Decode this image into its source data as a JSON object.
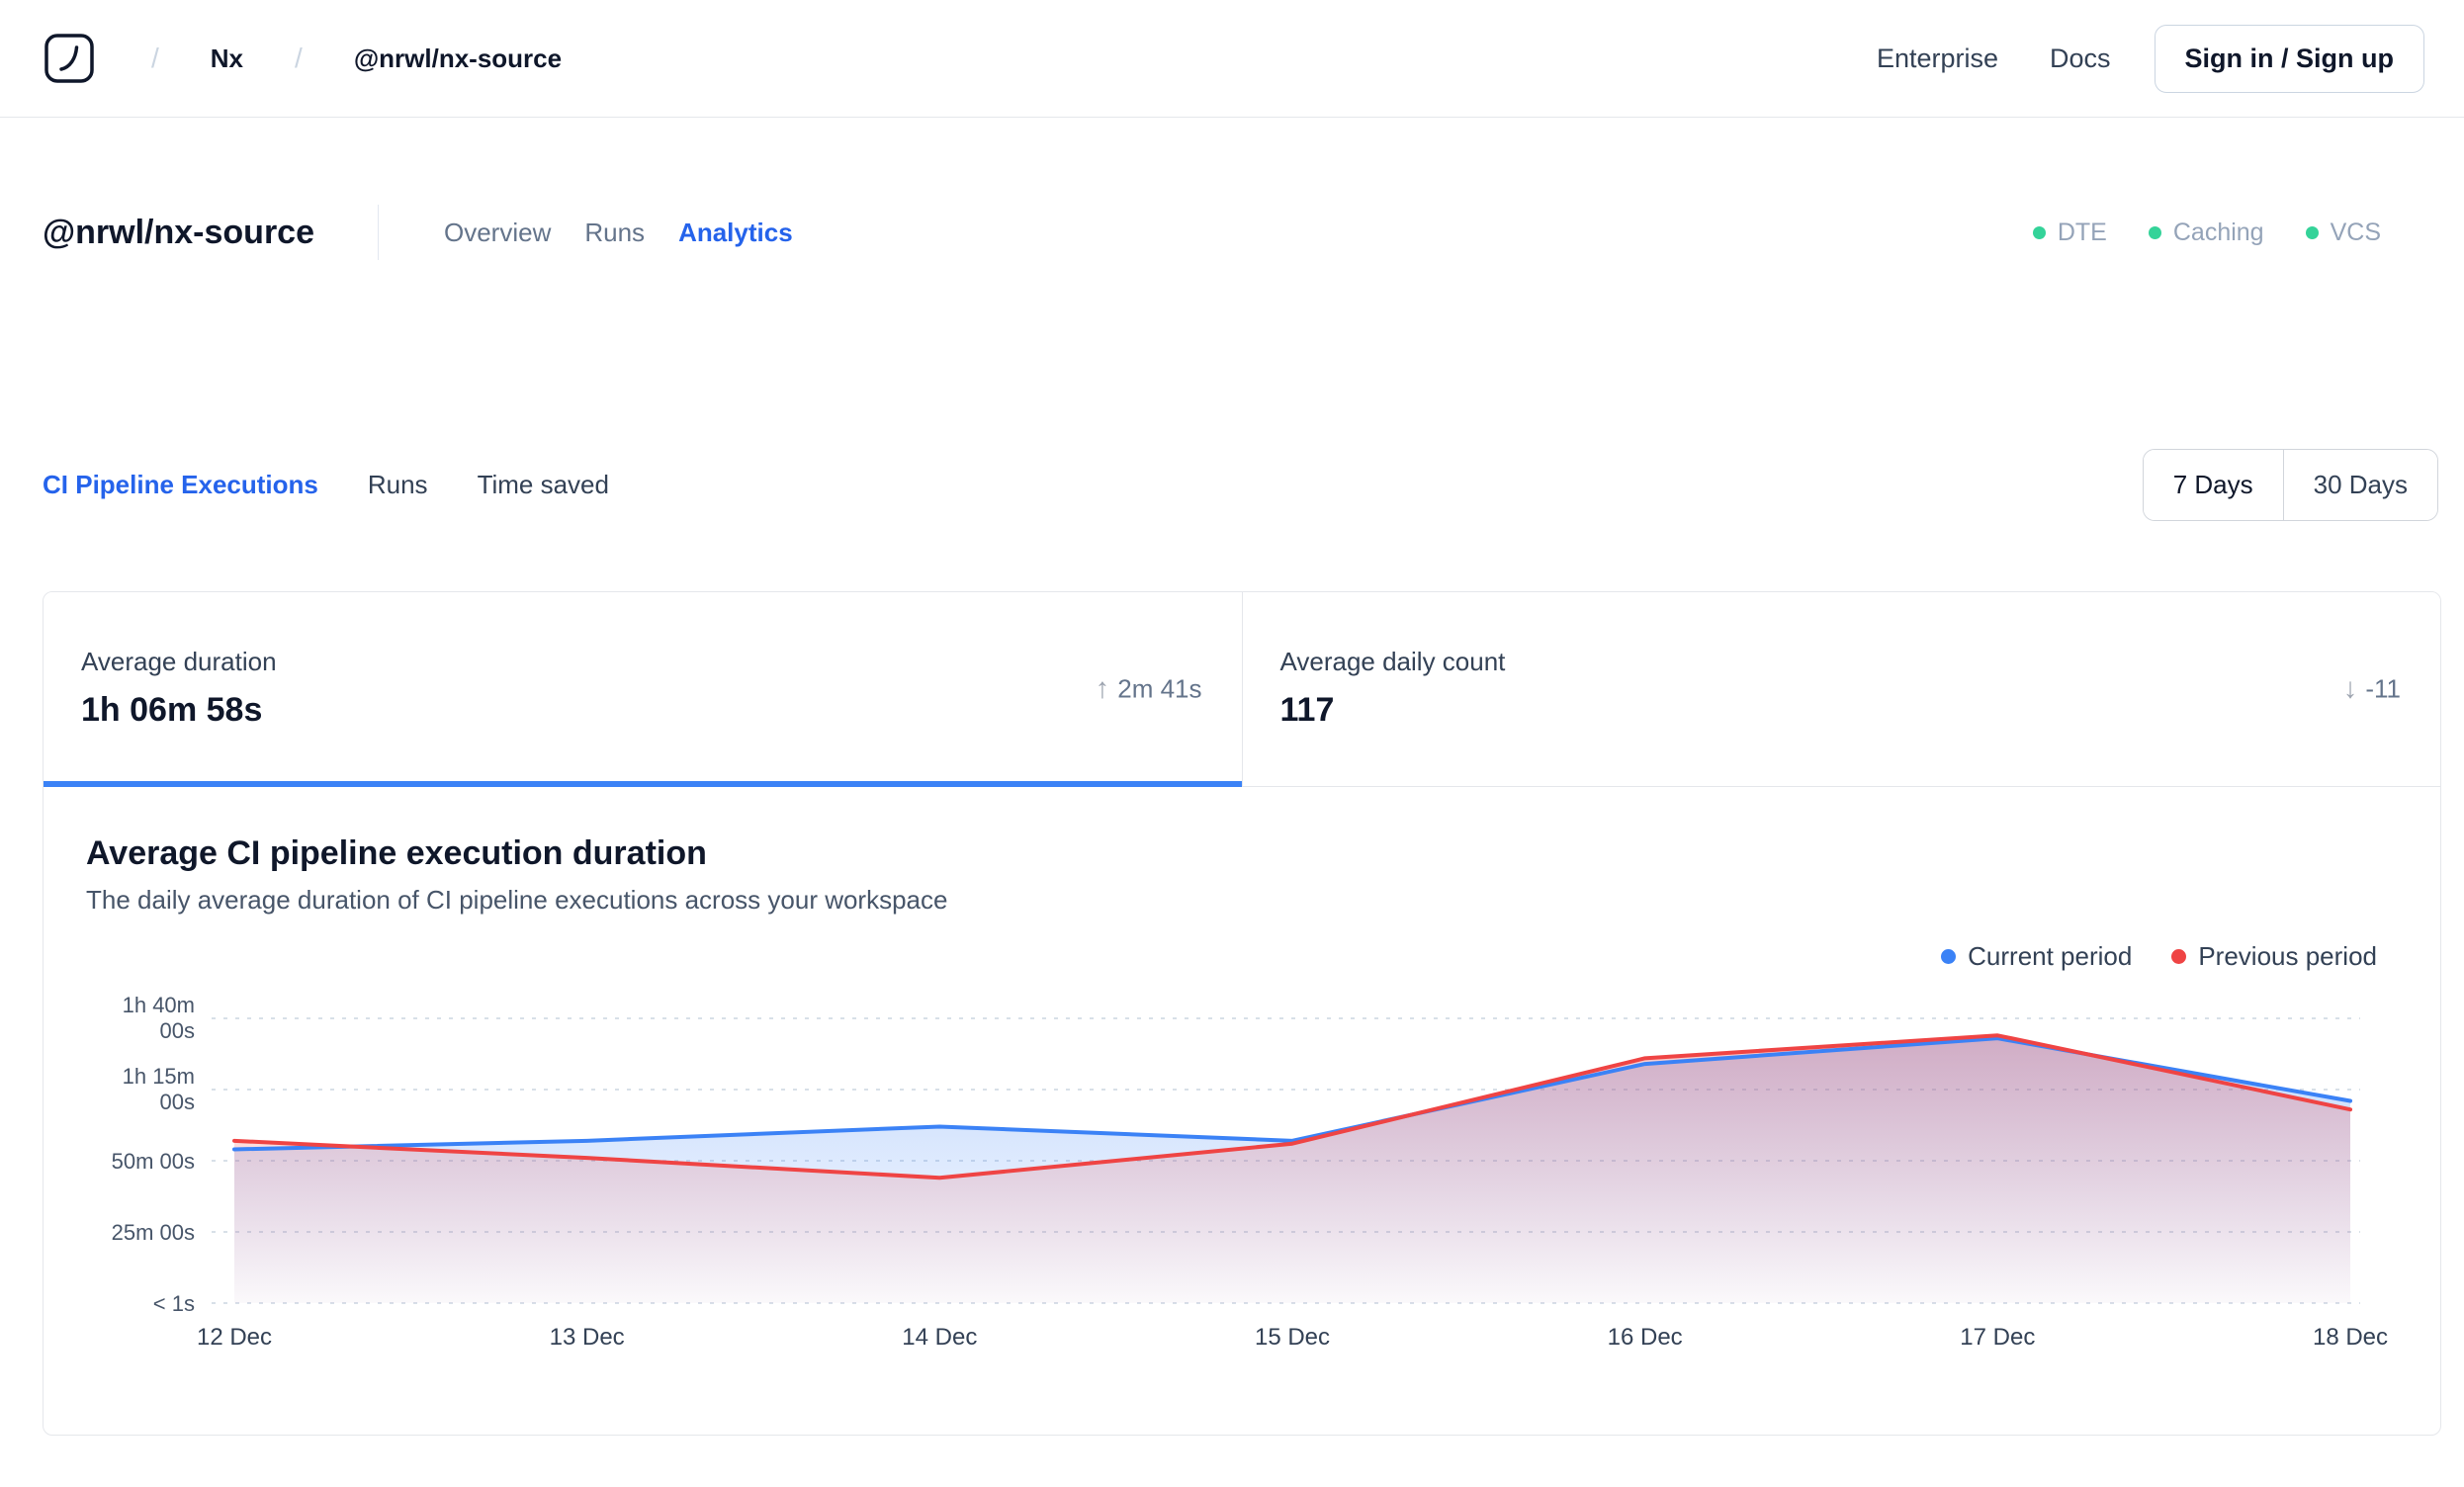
{
  "header": {
    "breadcrumb": {
      "separator": "/",
      "org": "Nx",
      "repo": "@nrwl/nx-source"
    },
    "nav": {
      "enterprise": "Enterprise",
      "docs": "Docs"
    },
    "auth_button": "Sign in / Sign up"
  },
  "workspace": {
    "title": "@nrwl/nx-source",
    "tabs": [
      {
        "label": "Overview"
      },
      {
        "label": "Runs"
      },
      {
        "label": "Analytics"
      }
    ],
    "active_tab": "Analytics",
    "status_indicators": [
      {
        "label": "DTE",
        "color": "#34d399"
      },
      {
        "label": "Caching",
        "color": "#34d399"
      },
      {
        "label": "VCS",
        "color": "#34d399"
      }
    ]
  },
  "analytics": {
    "metric_tabs": [
      {
        "label": "CI Pipeline Executions"
      },
      {
        "label": "Runs"
      },
      {
        "label": "Time saved"
      }
    ],
    "active_metric_tab": "CI Pipeline Executions",
    "range_options": [
      {
        "label": "7 Days"
      },
      {
        "label": "30 Days"
      }
    ],
    "selected_range": "7 Days"
  },
  "summary_cards": [
    {
      "label": "Average duration",
      "value": "1h 06m 58s",
      "delta": "2m 41s",
      "delta_direction": "up",
      "active": true
    },
    {
      "label": "Average daily count",
      "value": "117",
      "delta": "-11",
      "delta_direction": "down",
      "active": false
    }
  ],
  "chart_data": {
    "type": "line",
    "title": "Average CI pipeline execution duration",
    "subtitle": "The daily average duration of CI pipeline executions across your workspace",
    "x": [
      "12 Dec",
      "13 Dec",
      "14 Dec",
      "15 Dec",
      "16 Dec",
      "17 Dec",
      "18 Dec"
    ],
    "unit": "minutes",
    "ylim": [
      0,
      100
    ],
    "yticks": [
      {
        "value": 100,
        "label": "1h 40m\n00s"
      },
      {
        "value": 75,
        "label": "1h 15m\n00s"
      },
      {
        "value": 50,
        "label": "50m 00s"
      },
      {
        "value": 25,
        "label": "25m 00s"
      },
      {
        "value": 0,
        "label": "< 1s"
      }
    ],
    "grid": "dashed-horizontal",
    "legend_position": "top-right",
    "series": [
      {
        "name": "Current period",
        "color": "#3b82f6",
        "values": [
          54,
          57,
          62,
          57,
          84,
          93,
          71
        ]
      },
      {
        "name": "Previous period",
        "color": "#ef4444",
        "values": [
          57,
          51,
          44,
          56,
          86,
          94,
          68
        ]
      }
    ]
  }
}
